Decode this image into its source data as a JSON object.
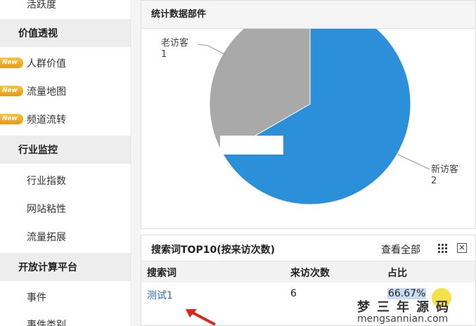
{
  "sidebar": {
    "items": [
      {
        "label": "活跃度",
        "kind": "item"
      },
      {
        "label": "价值透视",
        "kind": "group"
      },
      {
        "label": "人群价值",
        "kind": "new"
      },
      {
        "label": "流量地图",
        "kind": "new"
      },
      {
        "label": "频道流转",
        "kind": "new"
      },
      {
        "label": "行业监控",
        "kind": "group"
      },
      {
        "label": "行业指数",
        "kind": "item"
      },
      {
        "label": "网站粘性",
        "kind": "item"
      },
      {
        "label": "流量拓展",
        "kind": "item"
      },
      {
        "label": "开放计算平台",
        "kind": "group"
      },
      {
        "label": "事件",
        "kind": "item"
      },
      {
        "label": "事件类别",
        "kind": "item"
      }
    ],
    "new_badge": "New"
  },
  "stats_panel": {
    "title": "统计数据部件"
  },
  "chart_data": {
    "type": "pie",
    "title": "",
    "series": [
      {
        "name": "新访客",
        "value": 2,
        "color": "#2b8fd9"
      },
      {
        "name": "老访客",
        "value": 1,
        "color": "#a9a9a9"
      }
    ]
  },
  "top10_panel": {
    "title": "搜索词TOP10(按来访次数)",
    "view_all": "查看全部",
    "columns": [
      "搜索词",
      "来访次数",
      "占比"
    ],
    "rows": [
      {
        "term": "测试1",
        "visits": "6",
        "ratio": "66.67%"
      }
    ]
  },
  "watermark": {
    "line1": "梦三年源码",
    "line2": "mengsannian.com"
  }
}
